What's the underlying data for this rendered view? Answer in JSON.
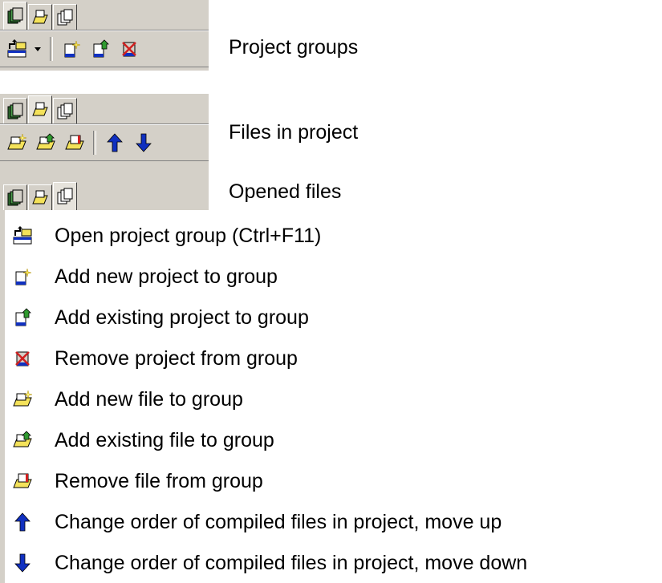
{
  "captions": {
    "project_groups": "Project groups",
    "files_in_project": "Files in project",
    "opened_files": "Opened files"
  },
  "tabs": [
    {
      "icon": "project-groups-tab-icon"
    },
    {
      "icon": "files-in-project-tab-icon"
    },
    {
      "icon": "opened-files-tab-icon"
    }
  ],
  "legend": [
    {
      "icon": "open-project-group-icon",
      "label": "Open project group (Ctrl+F11)"
    },
    {
      "icon": "add-new-project-icon",
      "label": "Add new project to group"
    },
    {
      "icon": "add-existing-project-icon",
      "label": "Add existing project to group"
    },
    {
      "icon": "remove-project-icon",
      "label": "Remove project from group"
    },
    {
      "icon": "add-new-file-icon",
      "label": "Add new file to group"
    },
    {
      "icon": "add-existing-file-icon",
      "label": "Add existing file to group"
    },
    {
      "icon": "remove-file-icon",
      "label": "Remove file from group"
    },
    {
      "icon": "move-up-icon",
      "label": "Change order of compiled files in project, move up"
    },
    {
      "icon": "move-down-icon",
      "label": "Change order of compiled files in project, move down"
    }
  ],
  "colors": {
    "panel_bg": "#d4d0c8",
    "icon_green": "#2f7a2f",
    "icon_yellow": "#f4e25a",
    "icon_red": "#d02020",
    "icon_blue": "#1030c0"
  }
}
